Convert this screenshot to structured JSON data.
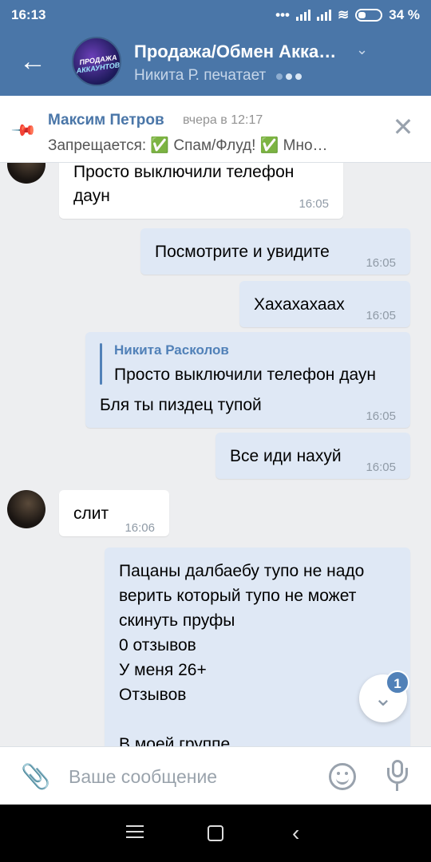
{
  "status_bar": {
    "time": "16:13",
    "battery": "34 %"
  },
  "header": {
    "title": "Продажа/Обмен Акка…",
    "subtitle": "Никита Р. печатает",
    "avatar_text_1": "ПРОДАЖА",
    "avatar_text_2": "АККАУНТОВ"
  },
  "pinned": {
    "author": "Максим Петров",
    "time": "вчера в 12:17",
    "text": "Запрещается: ✅ Спам/Флуд! ✅ Мно…"
  },
  "messages": [
    {
      "dir": "in",
      "text_lines": [
        "Просто выключили телефон",
        "даун"
      ],
      "time": "16:05"
    },
    {
      "dir": "out",
      "text": "Посмотрите и увидите",
      "time": "16:05"
    },
    {
      "dir": "out",
      "text": "Хахахахаах",
      "time": "16:05"
    },
    {
      "dir": "out",
      "reply_author": "Никита Расколов",
      "reply_text": "Просто выключили телефон даун",
      "text": "Бля ты пиздец тупой",
      "time": "16:05"
    },
    {
      "dir": "out",
      "text": "Все иди нахуй",
      "time": "16:05"
    },
    {
      "dir": "in",
      "text": "слит",
      "time": "16:06"
    },
    {
      "dir": "out",
      "text_lines": [
        "Пацаны далбаебу тупо не надо",
        "верить который тупо не может",
        "скинуть пруфы",
        "0 отзывов",
        "У меня 26+",
        "Отзывов",
        "",
        "В моей группе"
      ]
    }
  ],
  "scroll_down": {
    "badge": "1"
  },
  "composer": {
    "placeholder": "Ваше сообщение"
  },
  "colors": {
    "accent": "#4a76a8",
    "out_bubble": "#dfe8f5",
    "background": "#edeef0"
  }
}
